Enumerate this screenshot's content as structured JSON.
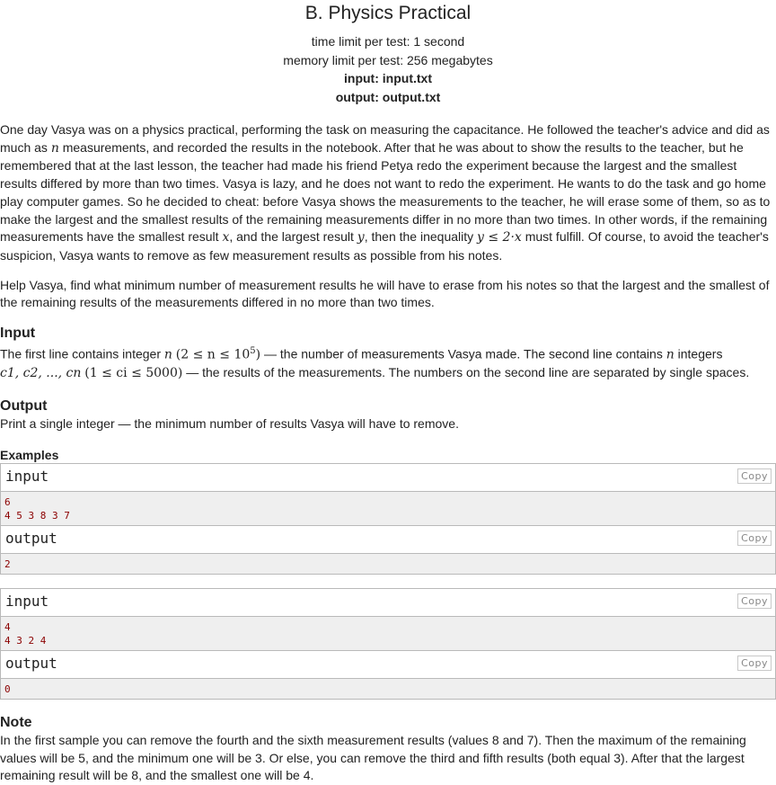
{
  "header": {
    "title": "B. Physics Practical",
    "time_limit": "time limit per test: 1 second",
    "memory_limit": "memory limit per test: 256 megabytes",
    "input_file": "input: input.txt",
    "output_file": "output: output.txt"
  },
  "statement": {
    "p1_a": "One day Vasya was on a physics practical, performing the task on measuring the capacitance. He followed the teacher's advice and did as much as ",
    "p1_n": "n",
    "p1_b": " measurements, and recorded the results in the notebook. After that he was about to show the results to the teacher, but he remembered that at the last lesson, the teacher had made his friend Petya redo the experiment because the largest and the smallest results differed by more than two times. Vasya is lazy, and he does not want to redo the experiment. He wants to do the task and go home play computer games. So he decided to cheat: before Vasya shows the measurements to the teacher, he will erase some of them, so as to make the largest and the smallest results of the remaining measurements differ in no more than two times. In other words, if the remaining measurements have the smallest result ",
    "p1_x": "x",
    "p1_c": ", and the largest result ",
    "p1_y": "y",
    "p1_d": ", then the inequality ",
    "p1_ineq": "y ≤ 2·x",
    "p1_e": " must fulfill. Of course, to avoid the teacher's suspicion, Vasya wants to remove as few measurement results as possible from his notes.",
    "p2": "Help Vasya, find what minimum number of measurement results he will have to erase from his notes so that the largest and the smallest of the remaining results of the measurements differed in no more than two times."
  },
  "input_section": {
    "title": "Input",
    "a": "The first line contains integer ",
    "n": "n",
    "constraint_n": "(2 ≤ n ≤ 10",
    "exp": "5",
    "close": ")",
    "b": " — the number of measurements Vasya made. The second line contains ",
    "n2": "n",
    "c": " integers",
    "seq": "c1, c2, ..., cn",
    "constraint_c": "(1 ≤ ci ≤ 5000)",
    "d": " — the results of the measurements. The numbers on the second line are separated by single spaces."
  },
  "output_section": {
    "title": "Output",
    "text": "Print a single integer — the minimum number of results Vasya will have to remove."
  },
  "examples": {
    "title": "Examples",
    "copy_label": "Copy",
    "input_label": "input",
    "output_label": "output",
    "items": [
      {
        "input": "6\n4 5 3 8 3 7",
        "output": "2"
      },
      {
        "input": "4\n4 3 2 4",
        "output": "0"
      }
    ]
  },
  "note": {
    "title": "Note",
    "text": "In the first sample you can remove the fourth and the sixth measurement results (values 8 and 7). Then the maximum of the remaining values will be 5, and the minimum one will be 3. Or else, you can remove the third and fifth results (both equal 3). After that the largest remaining result will be 8, and the smallest one will be 4."
  }
}
